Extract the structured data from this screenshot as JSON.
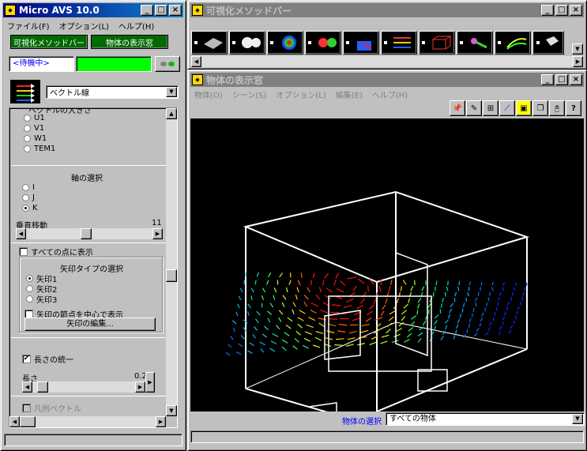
{
  "left": {
    "title": "Micro AVS 10.0",
    "menu": [
      "ファイル(F)",
      "オプション(L)",
      "ヘルプ(H)"
    ],
    "toolbar_buttons": [
      "可視化メソッドバー",
      "物体の表示窓"
    ],
    "status_text": "<待機中>",
    "method_select": "ベクトル線",
    "partial_heading": "ベクトルの大きさ",
    "component_options": [
      "U1",
      "V1",
      "W1",
      "TEM1"
    ],
    "axis_label": "軸の選択",
    "axis_options": [
      "I",
      "J",
      "K"
    ],
    "axis_selected": "K",
    "vertical_move_label": "垂直移動",
    "vertical_move_value": "11",
    "vertical_move_fraction": 0.47,
    "show_all_label": "すべての点に表示",
    "show_all_checked": false,
    "arrow_type_label": "矢印タイプの選択",
    "arrow_options": [
      "矢印1",
      "矢印2",
      "矢印3"
    ],
    "arrow_selected": "矢印1",
    "center_node_label": "矢印の節点を中心で表示",
    "center_node_checked": false,
    "edit_arrow_button": "矢印の編集...",
    "uniform_length_label": "長さの統一",
    "uniform_length_checked": true,
    "length_label": "長さ",
    "length_value": "0.2",
    "length_fraction": 0.05,
    "legend_label": "凡例ベクトル"
  },
  "methodbar": {
    "title": "可視化メソッドバー",
    "icons": [
      "contour-surface-icon",
      "isosurface-icon",
      "color-map-icon",
      "volume-icon",
      "numeric-label-icon",
      "vector-icon",
      "box-icon",
      "streamline-icon",
      "particle-icon",
      "other-icon"
    ]
  },
  "viewer": {
    "title": "物体の表示窓",
    "menu": [
      "物体(O)",
      "シーン(S)",
      "オプション(L)",
      "編集(E)",
      "ヘルプ(H)"
    ],
    "tools": [
      "pin-icon",
      "pencil-icon",
      "tree-icon",
      "axes-icon",
      "fit-icon",
      "window-icon",
      "mouse-icon",
      "help-icon"
    ],
    "object_select_label": "物体の選択",
    "object_select_value": "すべての物体"
  }
}
